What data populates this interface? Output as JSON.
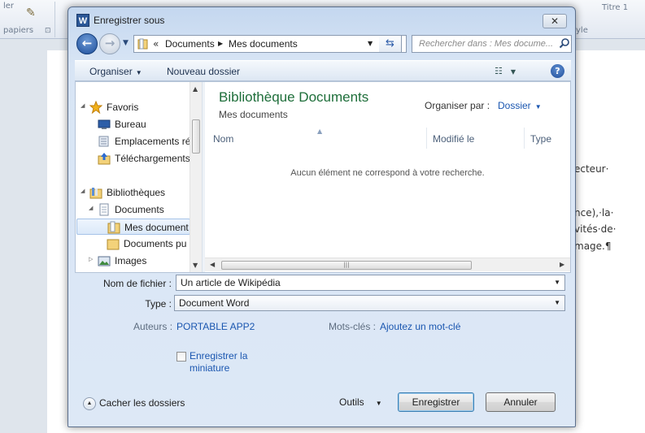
{
  "background": {
    "ribbon": {
      "group_label": "papiers",
      "style_label": "yle",
      "style_title": "Titre 1",
      "left_label": "ler"
    },
    "document_lines": [
      "ecteur·",
      "nce),·la·",
      "vités·de·",
      "mage.¶"
    ]
  },
  "dialog": {
    "title": "Enregistrer sous",
    "app_icon_letter": "W",
    "close_glyph": "✕",
    "nav": {
      "back_glyph": "←",
      "forward_glyph": "→",
      "chevron": "«",
      "crumbs": [
        "Documents",
        "Mes documents"
      ],
      "search_placeholder": "Rechercher dans : Mes docume..."
    },
    "toolbar": {
      "organize": "Organiser",
      "new_folder": "Nouveau dossier",
      "help_glyph": "?"
    },
    "tree": {
      "items": [
        {
          "label": "Favoris",
          "icon": "star-icon",
          "level": 0,
          "expander": "◢"
        },
        {
          "label": "Bureau",
          "icon": "desktop-icon",
          "level": 1
        },
        {
          "label": "Emplacements ré",
          "icon": "recent-places-icon",
          "level": 1
        },
        {
          "label": "Téléchargements",
          "icon": "downloads-icon",
          "level": 1
        },
        {
          "label": "Bibliothèques",
          "icon": "library-icon",
          "level": 0,
          "expander": "◢"
        },
        {
          "label": "Documents",
          "icon": "documents-icon",
          "level": 1,
          "expander": "◢"
        },
        {
          "label": "Mes document",
          "icon": "folder-icon",
          "level": 2,
          "selected": true
        },
        {
          "label": "Documents pu",
          "icon": "folder-icon",
          "level": 2
        },
        {
          "label": "Images",
          "icon": "pictures-icon",
          "level": 1,
          "expander": "▷"
        }
      ]
    },
    "content": {
      "library_title": "Bibliothèque Documents",
      "library_subtitle": "Mes documents",
      "arrange_label": "Organiser par :",
      "arrange_value": "Dossier",
      "columns": [
        "Nom",
        "Modifié le",
        "Type"
      ],
      "empty_message": "Aucun élément ne correspond à votre recherche."
    },
    "form": {
      "filename_label": "Nom de fichier :",
      "filename_value": "Un article de Wikipédia",
      "type_label": "Type :",
      "type_value": "Document Word",
      "authors_label": "Auteurs :",
      "authors_value": "PORTABLE APP2",
      "keywords_label": "Mots-clés :",
      "keywords_value": "Ajoutez un mot-clé",
      "thumbnail_label": "Enregistrer la miniature",
      "thumbnail_checked": false
    },
    "footer": {
      "hide_folders": "Cacher les dossiers",
      "tools": "Outils",
      "save": "Enregistrer",
      "cancel": "Annuler"
    }
  },
  "colors": {
    "library_title": "#1e6e3a",
    "link": "#1a56b0",
    "dialog_frame": "#c4d7ef"
  }
}
